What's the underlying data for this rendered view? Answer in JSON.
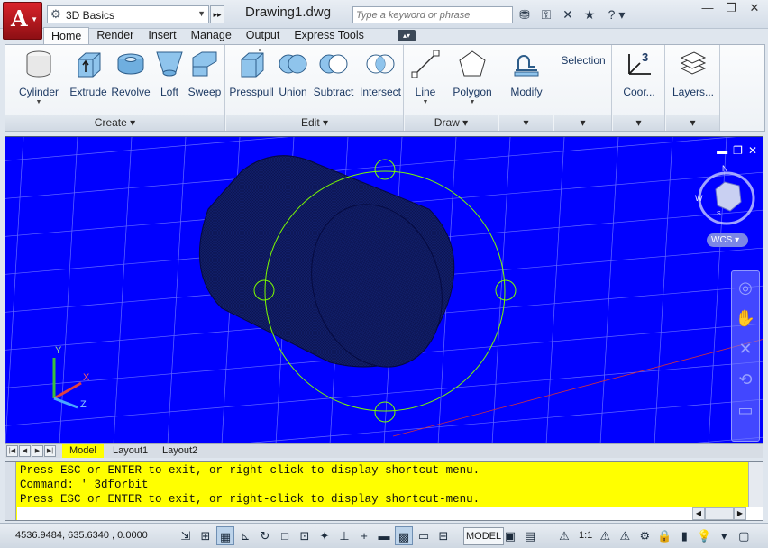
{
  "titlebar": {
    "app_menu_icon": "autocad-logo-icon",
    "workspace": "3D Basics",
    "document_title": "Drawing1.dwg",
    "search_placeholder": "Type a keyword or phrase",
    "icons": [
      "binoculars-icon",
      "key-icon",
      "exchange-icon",
      "star-icon",
      "help-icon"
    ],
    "window_controls": [
      "minimize-icon",
      "restore-icon",
      "close-icon"
    ]
  },
  "ribbon_tabs": [
    "Home",
    "Render",
    "Insert",
    "Manage",
    "Output",
    "Express Tools"
  ],
  "ribbon_active_tab": "Home",
  "panels": {
    "create": {
      "label": "Create",
      "tools": [
        "Cylinder",
        "Extrude",
        "Revolve",
        "Loft",
        "Sweep"
      ]
    },
    "edit": {
      "label": "Edit",
      "tools": [
        "Presspull",
        "Union",
        "Subtract",
        "Intersect"
      ]
    },
    "draw": {
      "label": "Draw",
      "tools": [
        "Line",
        "Polygon"
      ]
    },
    "modify": {
      "label": "Modify"
    },
    "selection": {
      "label": "Selection"
    },
    "coordinates": {
      "label": "Coor..."
    },
    "layers": {
      "label": "Layers..."
    }
  },
  "viewport": {
    "background": "#0000ff",
    "viewcube_compass": [
      "N",
      "W",
      "S"
    ],
    "wcs_label": "WCS",
    "ucs_axes": [
      "Y",
      "X",
      "Z"
    ]
  },
  "layout_tabs": [
    "Model",
    "Layout1",
    "Layout2"
  ],
  "active_layout": "Model",
  "command_lines": [
    "Press ESC or ENTER to exit, or right-click to display shortcut-menu.",
    "Command: '_3dforbit",
    "Press ESC or ENTER to exit, or right-click to display shortcut-menu."
  ],
  "status": {
    "coordinates": "4536.9484, 635.6340 , 0.0000",
    "model_label": "MODEL",
    "annotation_scale": "1:1"
  },
  "colors": {
    "command_bg": "#ffff00",
    "orbit_circle": "#7cfc00",
    "app_red": "#c8102e"
  }
}
